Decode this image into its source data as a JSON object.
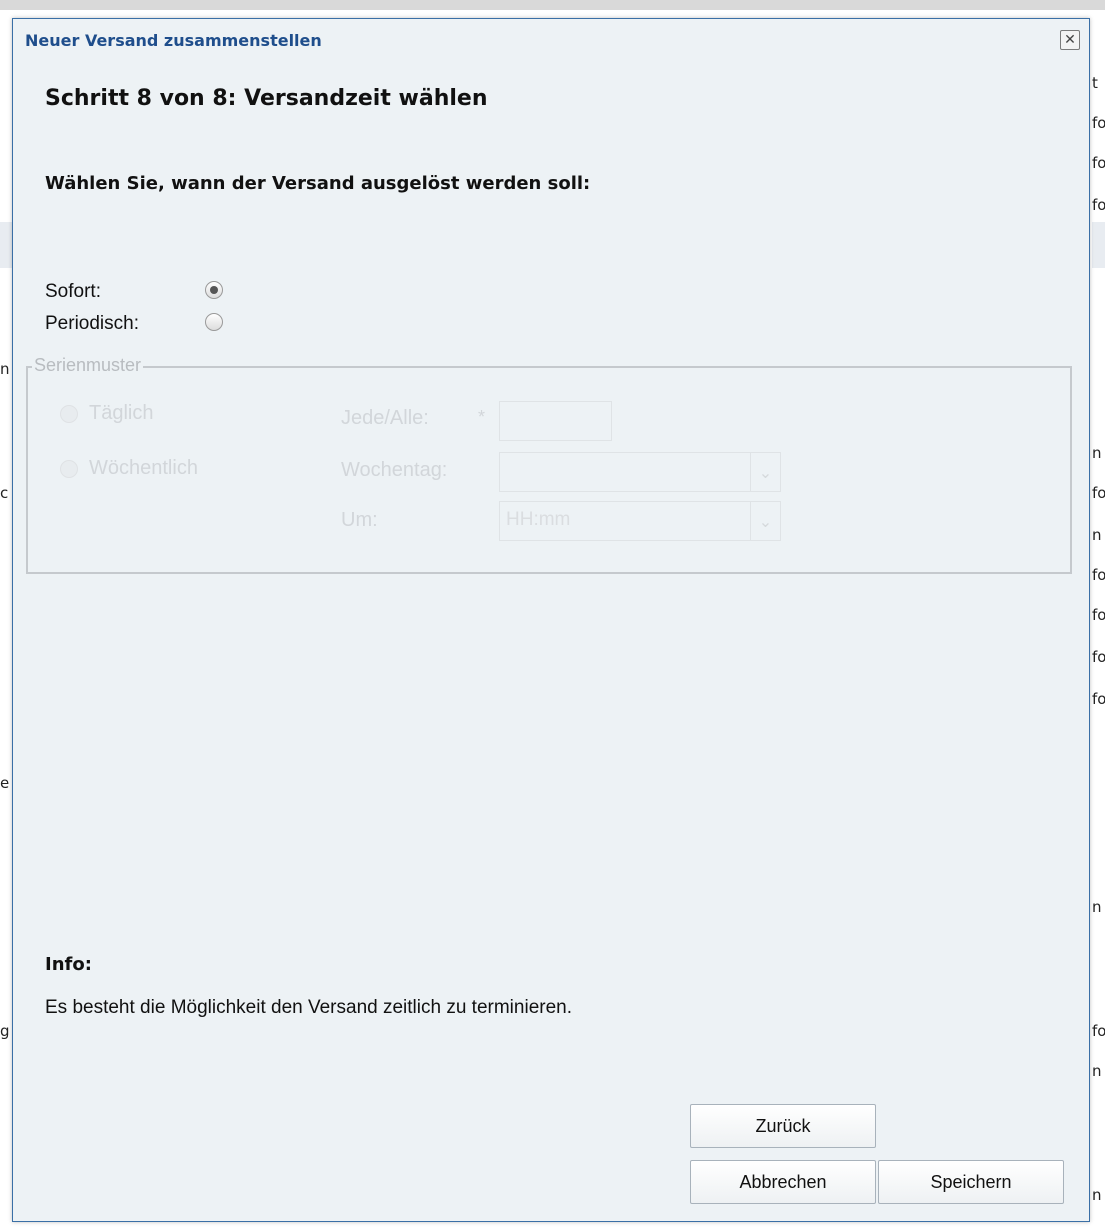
{
  "background": {
    "right_fragments": [
      "t",
      "fo",
      "fo",
      "fo",
      "n",
      "fo",
      "n",
      "fo",
      "fo",
      "fo",
      "fo",
      "n",
      "fo",
      "n",
      "n"
    ],
    "left_fragments": [
      "n",
      "c",
      "e",
      "g"
    ]
  },
  "dialog": {
    "title": "Neuer Versand zusammenstellen",
    "close_glyph": "✕",
    "step_title": "Schritt 8 von 8: Versandzeit wählen",
    "prompt": "Wählen Sie, wann der Versand ausgelöst werden soll:",
    "options": {
      "sofort": {
        "label": "Sofort:",
        "checked": true
      },
      "periodisch": {
        "label": "Periodisch:",
        "checked": false
      }
    },
    "serienmuster": {
      "legend": "Serienmuster",
      "taeglich": "Täglich",
      "woechentlich": "Wöchentlich",
      "jede_alle_label": "Jede/Alle:",
      "required_mark": "*",
      "jede_alle_value": "",
      "wochentag_label": "Wochentag:",
      "wochentag_value": "",
      "um_label": "Um:",
      "um_placeholder": "HH:mm",
      "dropdown_glyph": "⌄"
    },
    "info": {
      "heading": "Info:",
      "text": "Es besteht die Möglichkeit den Versand zeitlich zu terminieren."
    },
    "buttons": {
      "back": "Zurück",
      "cancel": "Abbrechen",
      "save": "Speichern"
    }
  }
}
